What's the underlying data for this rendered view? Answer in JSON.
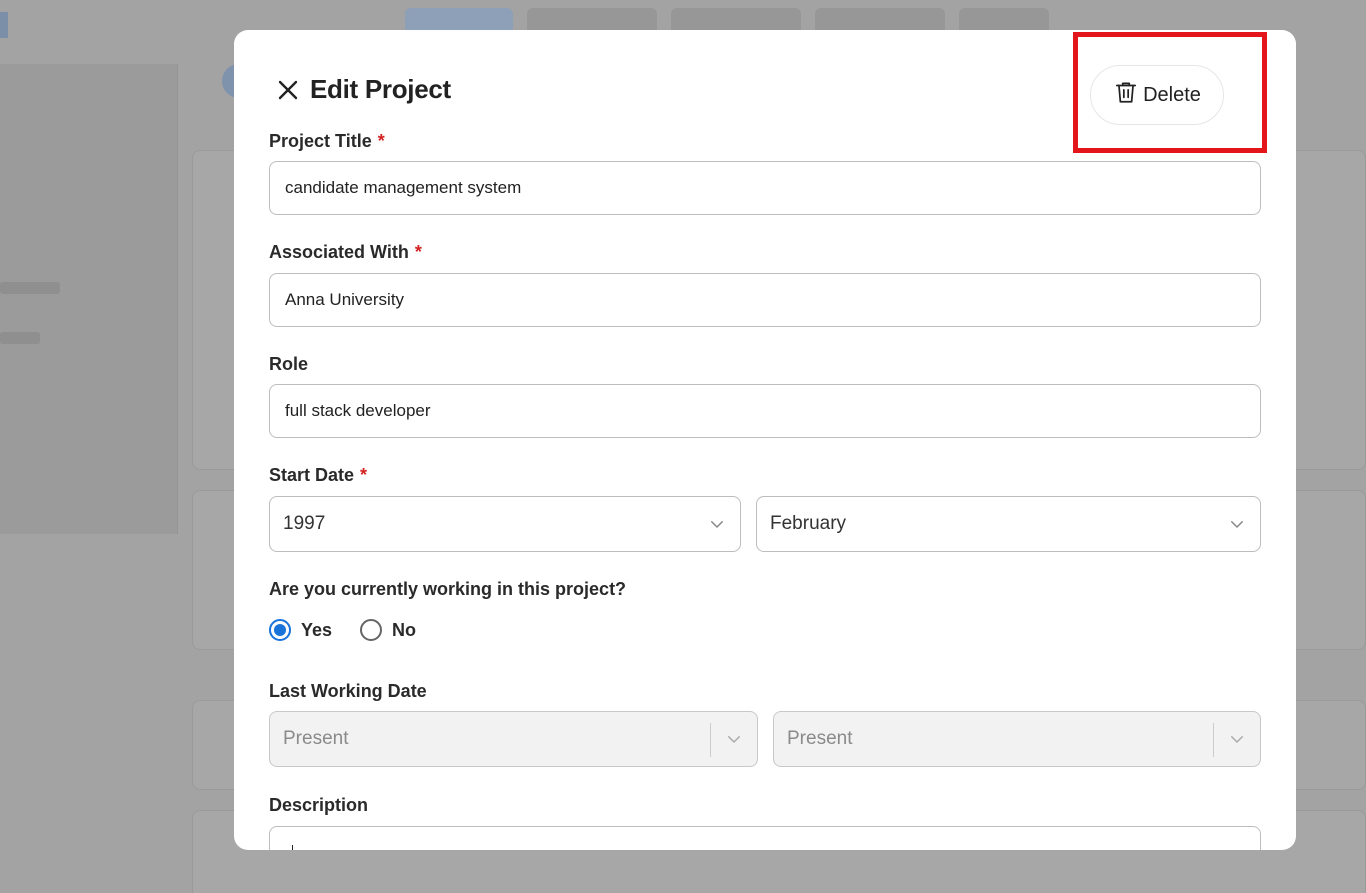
{
  "modal": {
    "title": "Edit Project",
    "delete_label": "Delete"
  },
  "fields": {
    "project_title": {
      "label": "Project Title",
      "required_mark": "*",
      "value": "candidate management system"
    },
    "associated_with": {
      "label": "Associated With",
      "required_mark": "*",
      "value": "Anna University"
    },
    "role": {
      "label": "Role",
      "value": "full stack developer"
    },
    "start_date": {
      "label": "Start Date",
      "required_mark": "*",
      "year": "1997",
      "month": "February"
    },
    "currently_working": {
      "question": "Are you currently working in this project?",
      "yes_label": "Yes",
      "no_label": "No",
      "selected": "Yes"
    },
    "last_working_date": {
      "label": "Last Working Date",
      "year": "Present",
      "month": "Present"
    },
    "description": {
      "label": "Description"
    }
  },
  "icons": {
    "close": "close-icon",
    "delete": "trash-icon",
    "dropdown": "chevron-down-icon"
  },
  "colors": {
    "accent": "#1a73d9",
    "required": "#d32020",
    "highlight": "#e3161b"
  }
}
